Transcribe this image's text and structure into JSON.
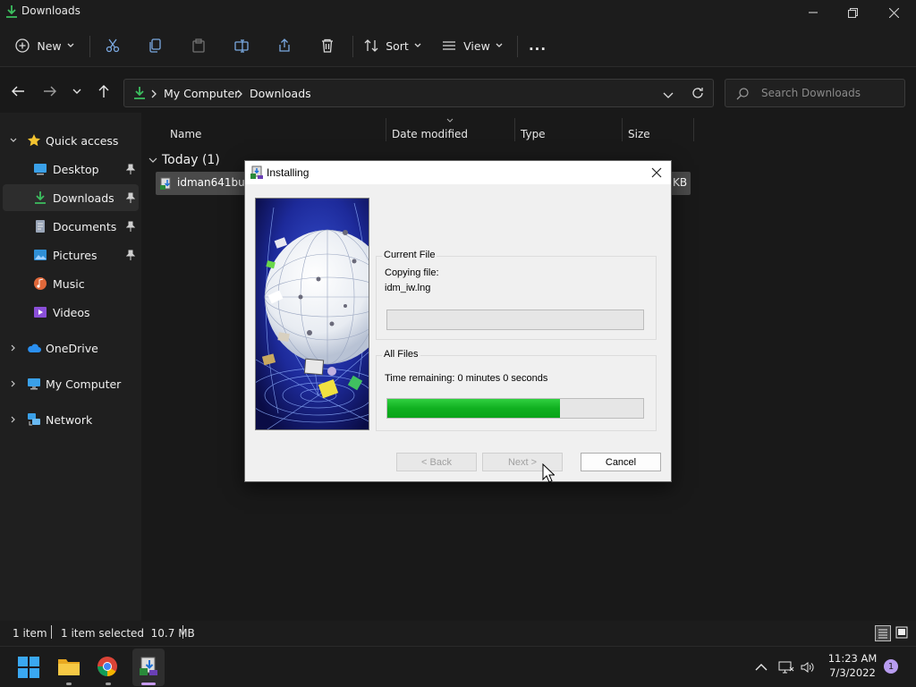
{
  "window": {
    "title": "Downloads"
  },
  "toolbar": {
    "new_label": "New",
    "sort_label": "Sort",
    "view_label": "View",
    "more_label": "..."
  },
  "address": {
    "path": [
      "My Computer",
      "Downloads"
    ],
    "search_placeholder": "Search Downloads"
  },
  "nav": {
    "quick_access": "Quick access",
    "items": [
      {
        "label": "Desktop",
        "icon": "desktop-icon",
        "pinned": true
      },
      {
        "label": "Downloads",
        "icon": "download-icon",
        "pinned": true,
        "selected": true
      },
      {
        "label": "Documents",
        "icon": "documents-icon",
        "pinned": true
      },
      {
        "label": "Pictures",
        "icon": "pictures-icon",
        "pinned": true
      },
      {
        "label": "Music",
        "icon": "music-icon",
        "pinned": false
      },
      {
        "label": "Videos",
        "icon": "videos-icon",
        "pinned": false
      }
    ],
    "roots": [
      {
        "label": "OneDrive",
        "icon": "cloud-icon"
      },
      {
        "label": "My Computer",
        "icon": "computer-icon"
      },
      {
        "label": "Network",
        "icon": "network-icon"
      }
    ]
  },
  "columns": [
    "Name",
    "Date modified",
    "Type",
    "Size"
  ],
  "group_header": "Today (1)",
  "file": {
    "name": "idman641build",
    "size_visible": "KB"
  },
  "status": {
    "count": "1 item",
    "selected": "1 item selected  10.7 MB"
  },
  "clock": {
    "time": "11:23 AM",
    "date": "7/3/2022",
    "notifications": "1"
  },
  "dialog": {
    "title": "Installing",
    "current_file_group": "Current File",
    "copying_label": "Copying file:",
    "copying_file": "idm_iw.lng",
    "current_progress": 0,
    "all_files_group": "All Files",
    "time_remaining": "Time remaining: 0 minutes 0 seconds",
    "all_progress": 0.675,
    "back_label": "< Back",
    "next_label": "Next >",
    "cancel_label": "Cancel"
  },
  "colors": {
    "progress": "#10b020",
    "accent_folder": "#f3c33a",
    "download_green": "#3cbf5f"
  }
}
